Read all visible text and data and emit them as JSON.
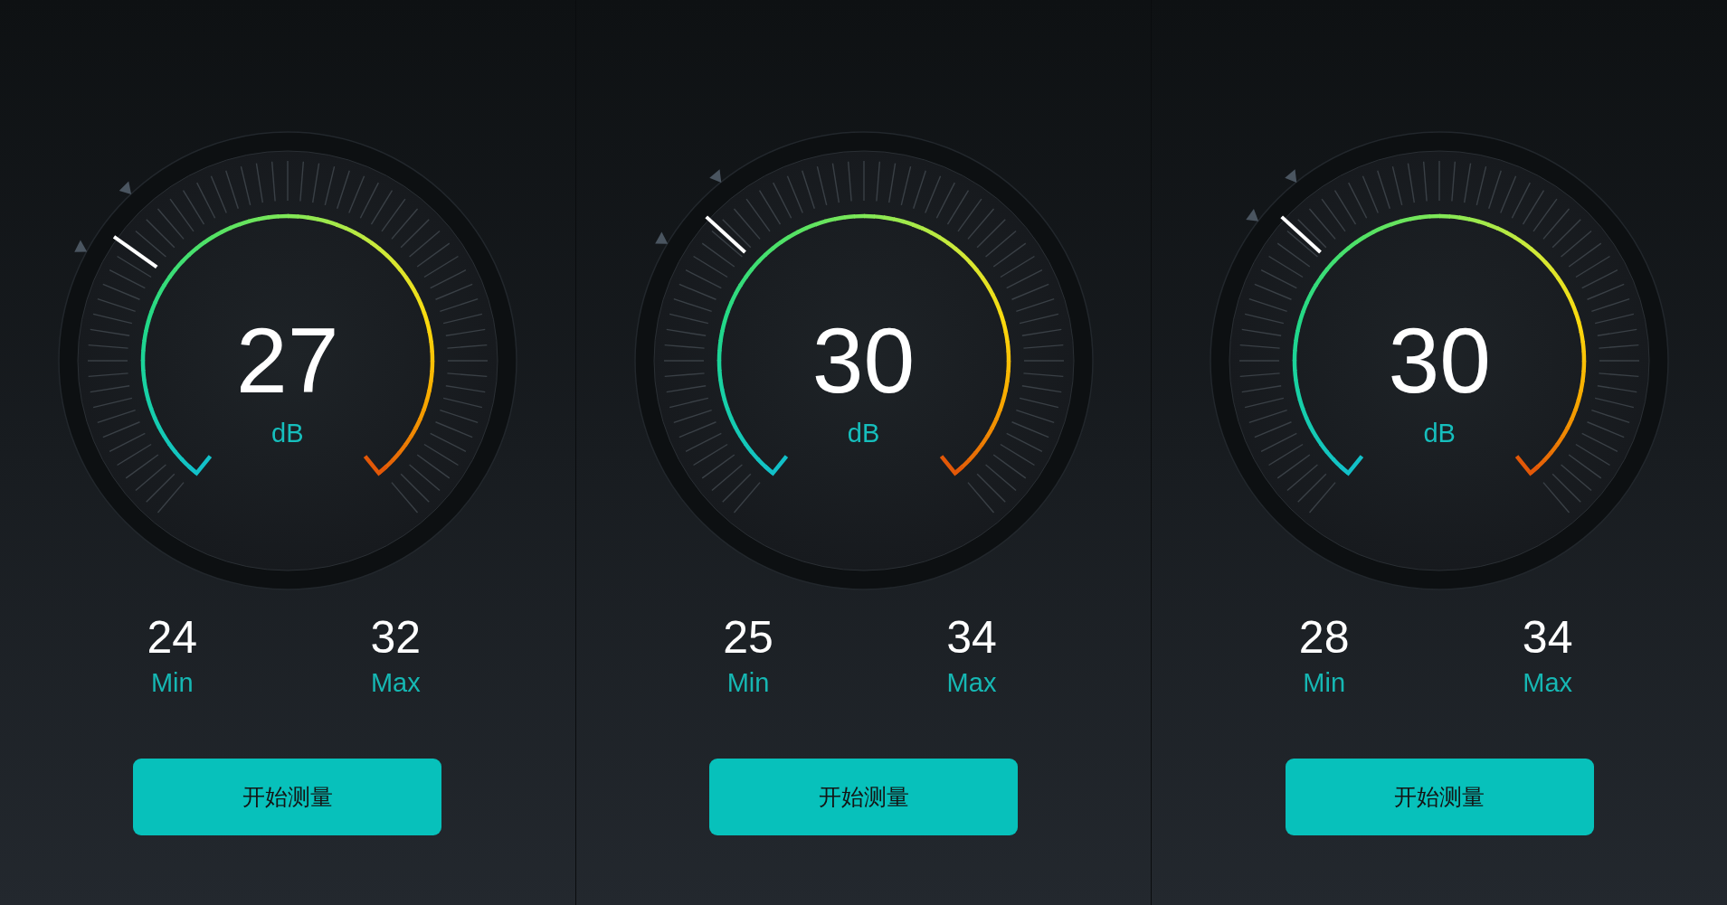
{
  "gauges": [
    {
      "reading": "27",
      "unit": "dB",
      "min": {
        "value": "24",
        "label": "Min"
      },
      "max": {
        "value": "32",
        "label": "Max"
      },
      "button": "开始测量"
    },
    {
      "reading": "30",
      "unit": "dB",
      "min": {
        "value": "25",
        "label": "Min"
      },
      "max": {
        "value": "34",
        "label": "Max"
      },
      "button": "开始测量"
    },
    {
      "reading": "30",
      "unit": "dB",
      "min": {
        "value": "28",
        "label": "Min"
      },
      "max": {
        "value": "34",
        "label": "Max"
      },
      "button": "开始测量"
    }
  ]
}
